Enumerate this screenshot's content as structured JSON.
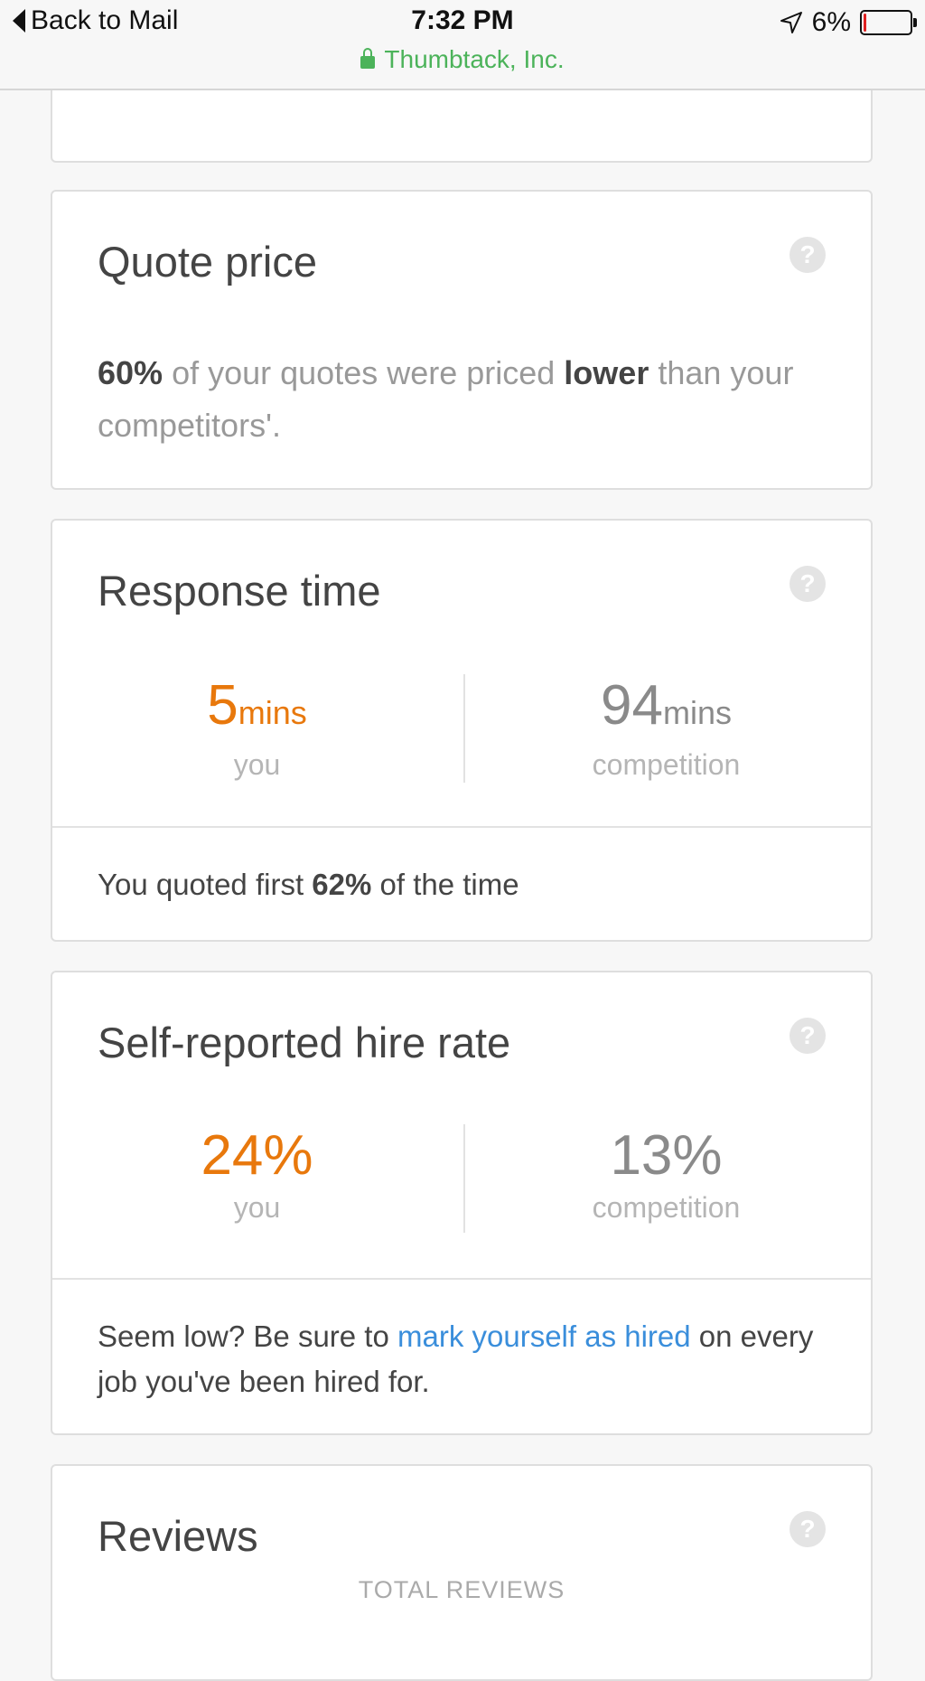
{
  "status_bar": {
    "back_label": "Back to Mail",
    "time": "7:32 PM",
    "site": "Thumbtack, Inc.",
    "battery": "6%",
    "battery_level_percent": 6,
    "accent_green": "#4cb35a"
  },
  "help_icon": "?",
  "quote_price": {
    "title": "Quote price",
    "percent": "60%",
    "text_a": " of your quotes were priced ",
    "emph": "lower",
    "text_b": " than your competitors'."
  },
  "response_time": {
    "title": "Response time",
    "you_value": "5",
    "you_unit": "mins",
    "you_label": "you",
    "comp_value": "94",
    "comp_unit": "mins",
    "comp_label": "competition",
    "foot_a": "You quoted first ",
    "foot_bold": "62%",
    "foot_b": " of the time"
  },
  "hire_rate": {
    "title": "Self-reported hire rate",
    "you_value": "24%",
    "you_label": "you",
    "comp_value": "13%",
    "comp_label": "competition",
    "foot_a": "Seem low? Be sure to ",
    "foot_link": "mark yourself as hired",
    "foot_b": " on every job you've been hired for."
  },
  "reviews": {
    "title": "Reviews",
    "total_label": "TOTAL REVIEWS"
  },
  "colors": {
    "you": "#e8780c",
    "competition": "#8a8a8a",
    "link": "#3a8edb"
  }
}
